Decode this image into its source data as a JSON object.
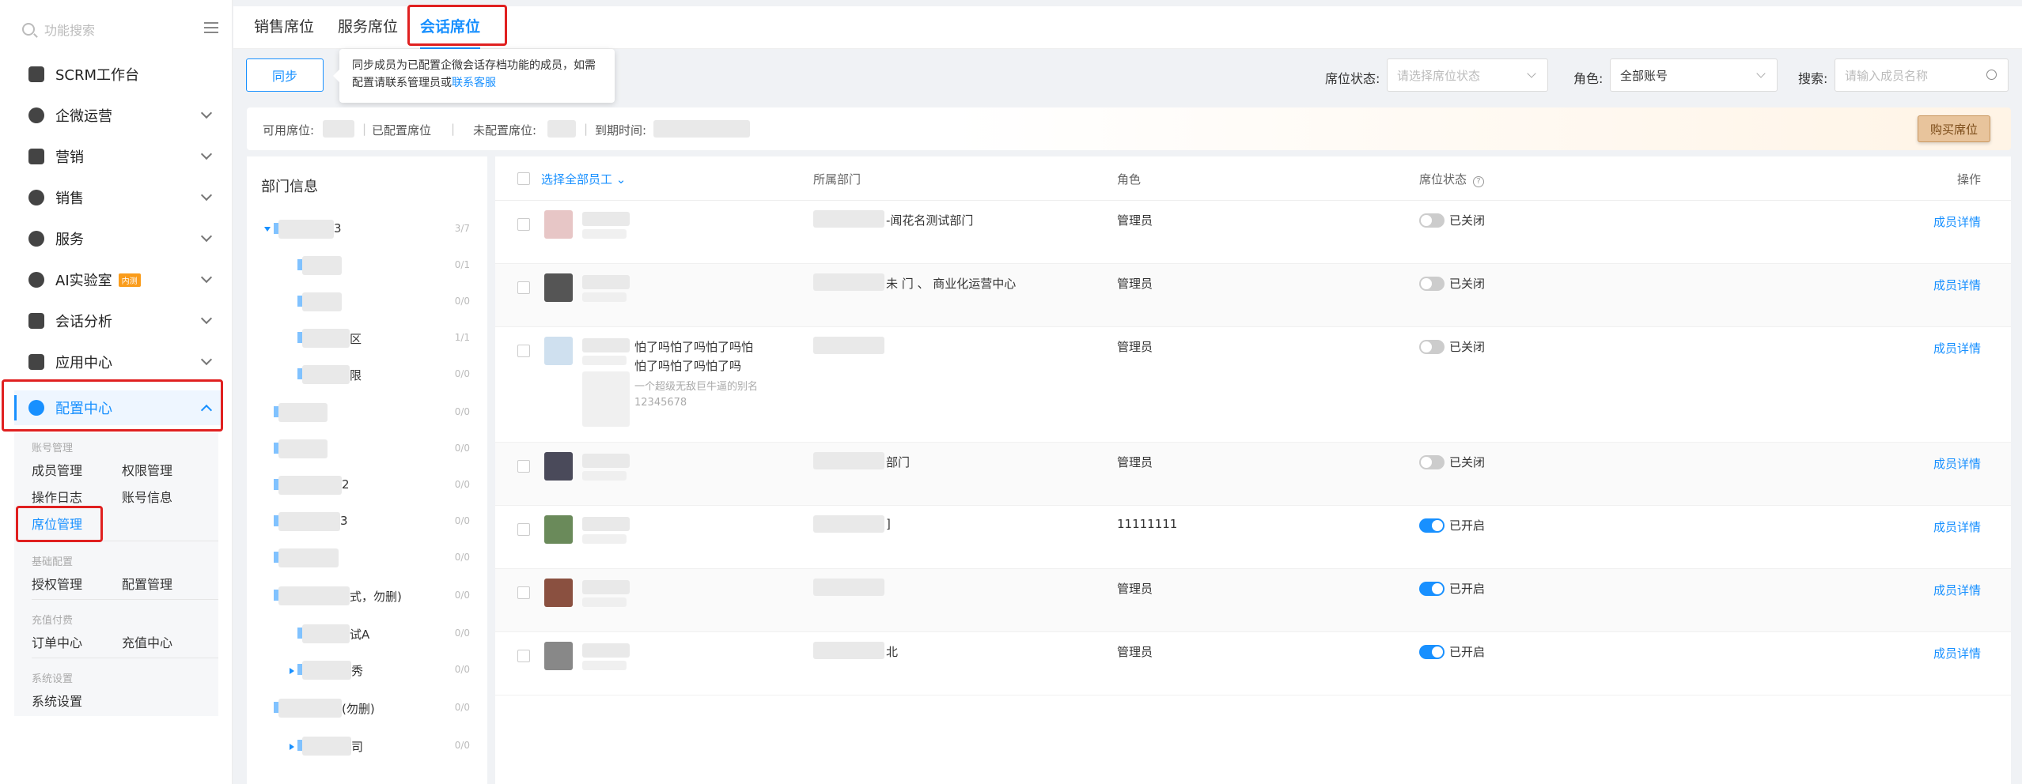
{
  "sidebar": {
    "search_placeholder": "功能搜索",
    "nav": [
      {
        "label": "SCRM工作台",
        "icon": "monitor-icon"
      },
      {
        "label": "企微运营",
        "icon": "operation-icon"
      },
      {
        "label": "营销",
        "icon": "marketing-icon"
      },
      {
        "label": "销售",
        "icon": "sales-icon"
      },
      {
        "label": "服务",
        "icon": "service-icon"
      },
      {
        "label": "AI实验室",
        "icon": "ai-icon",
        "badge": "内测"
      },
      {
        "label": "会话分析",
        "icon": "chat-analysis-icon"
      },
      {
        "label": "应用中心",
        "icon": "apps-icon"
      },
      {
        "label": "配置中心",
        "icon": "settings-icon"
      }
    ],
    "config_groups": {
      "account_mgmt": {
        "title": "账号管理",
        "items": [
          "成员管理",
          "权限管理",
          "操作日志",
          "账号信息",
          "席位管理"
        ]
      },
      "basic_config": {
        "title": "基础配置",
        "items": [
          "授权管理",
          "配置管理"
        ]
      },
      "recharge": {
        "title": "充值付费",
        "items": [
          "订单中心",
          "充值中心"
        ]
      },
      "system": {
        "title": "系统设置",
        "items": [
          "系统设置"
        ]
      }
    }
  },
  "tabs": [
    "销售席位",
    "服务席位",
    "会话席位"
  ],
  "toolbar": {
    "sync_label": "同步",
    "tip_text_1": "同步成员为已配置企微会话存档功能的成员，如需",
    "tip_text_2": "配置请联系管理员或",
    "tip_link": "联系客服",
    "seat_status_label": "席位状态:",
    "seat_status_placeholder": "请选择席位状态",
    "role_label": "角色:",
    "role_value": "全部账号",
    "search_label": "搜索:",
    "search_placeholder": "请输入成员名称"
  },
  "infobar": {
    "available": "可用席位:",
    "configured": "已配置席位",
    "unconfigured": "未配置席位:",
    "expire": "到期时间:",
    "buy": "购买席位"
  },
  "dept": {
    "title": "部门信息",
    "rows": [
      {
        "name": "3",
        "count": "3/7"
      },
      {
        "name": "",
        "count": "0/1"
      },
      {
        "name": "",
        "count": "0/0"
      },
      {
        "name": "区",
        "count": "1/1"
      },
      {
        "name": "限",
        "count": "0/0"
      },
      {
        "name": "",
        "count": "0/0"
      },
      {
        "name": "",
        "count": "0/0"
      },
      {
        "name": "2",
        "count": "0/0"
      },
      {
        "name": "3",
        "count": "0/0"
      },
      {
        "name": "",
        "count": "0/0"
      },
      {
        "name": "式，勿删)",
        "count": "0/0"
      },
      {
        "name": "试A",
        "count": "0/0"
      },
      {
        "name": "秀",
        "count": "0/0"
      },
      {
        "name": "(勿删)",
        "count": "0/0"
      },
      {
        "name": "司",
        "count": "0/0"
      }
    ]
  },
  "table": {
    "headers": {
      "select_all": "选择全部员工",
      "dept": "所属部门",
      "role": "角色",
      "status": "席位状态",
      "action": "操作"
    },
    "rows": [
      {
        "dept": "-闻花名测试部门",
        "role": "管理员",
        "on": false,
        "status": "已关闭",
        "action": "成员详情"
      },
      {
        "dept": "未 门 、 商业化运营中心",
        "role": "管理员",
        "on": false,
        "status": "已关闭",
        "action": "成员详情"
      },
      {
        "dept": "",
        "role": "管理员",
        "on": false,
        "status": "已关闭",
        "action": "成员详情",
        "name_line1": "怕了吗怕了吗怕了吗怕",
        "name_line2": "怕了吗怕了吗怕了吗",
        "alias": "一个超级无敌巨牛逼的别名",
        "phone": "12345678"
      },
      {
        "dept": "部门",
        "role": "管理员",
        "on": false,
        "status": "已关闭",
        "action": "成员详情"
      },
      {
        "dept": "]",
        "role": "11111111",
        "on": true,
        "status": "已开启",
        "action": "成员详情"
      },
      {
        "dept": "",
        "role": "管理员",
        "on": true,
        "status": "已开启",
        "action": "成员详情"
      },
      {
        "dept": "北",
        "role": "管理员",
        "on": true,
        "status": "已开启",
        "action": "成员详情"
      }
    ]
  },
  "colors": {
    "accent": "#1890ff",
    "highlight": "#e02020",
    "buy": "#e8c49c"
  }
}
